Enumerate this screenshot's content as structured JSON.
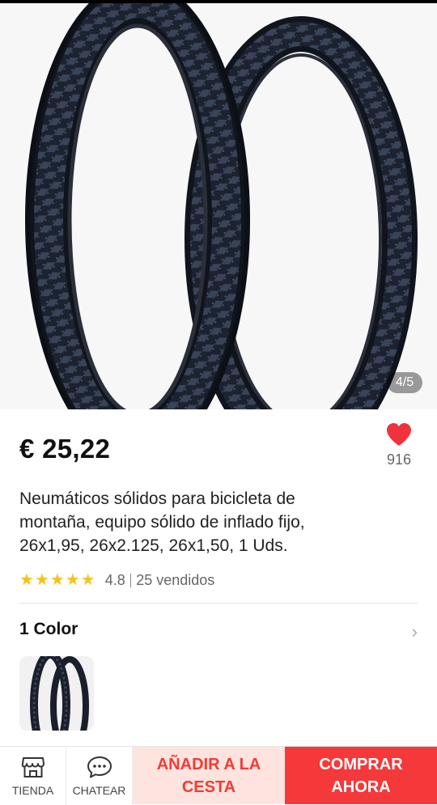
{
  "product": {
    "price": "€ 25,22",
    "image_counter": "4/5",
    "favorites": "916",
    "title_lines": [
      "Neumáticos sólidos para bicicleta de",
      "montaña, equipo sólido de inflado fijo,",
      "26x1,95, 26x2.125, 26x1,50, 1 Uds."
    ],
    "rating": {
      "stars": 5,
      "score": "4.8",
      "sold": "25 vendidos"
    }
  },
  "variants": {
    "label": "1 Color"
  },
  "bottom_bar": {
    "store_label": "TIENDA",
    "chat_label": "CHATEAR",
    "cart_line1": "AÑADIR A LA",
    "cart_line2": "CESTA",
    "buy_line1": "COMPRAR",
    "buy_line2": "AHORA"
  },
  "colors": {
    "accent": "#f5383a",
    "cart_bg": "#ffe3df",
    "star": "#f8c21b",
    "heart": "#f0323c"
  },
  "icons": {
    "favorite": "heart-icon",
    "more": "chevron-right-icon",
    "store": "store-icon",
    "chat": "chat-bubble-icon"
  }
}
